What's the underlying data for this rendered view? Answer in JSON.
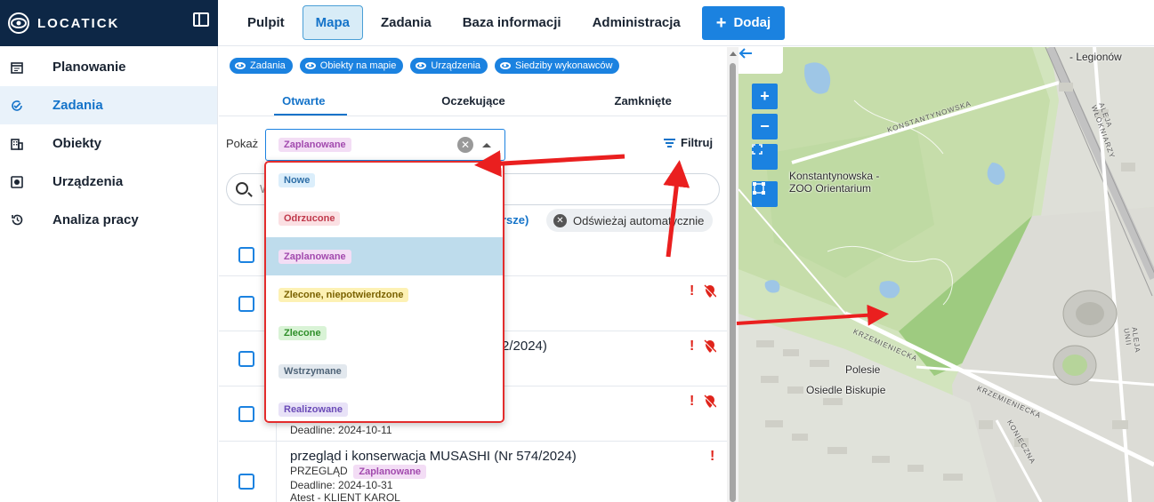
{
  "app": {
    "brand": "LOCATICK"
  },
  "sidebar": {
    "items": [
      {
        "label": "Planowanie",
        "icon": "calendar-icon"
      },
      {
        "label": "Zadania",
        "icon": "task-check-icon",
        "active": true
      },
      {
        "label": "Obiekty",
        "icon": "building-icon"
      },
      {
        "label": "Urządzenia",
        "icon": "device-icon"
      },
      {
        "label": "Analiza pracy",
        "icon": "history-icon"
      }
    ]
  },
  "topnav": {
    "items": [
      "Pulpit",
      "Mapa",
      "Zadania",
      "Baza informacji",
      "Administracja"
    ],
    "active": "Mapa",
    "add_label": "Dodaj"
  },
  "layers": [
    "Zadania",
    "Obiekty na mapie",
    "Urządzenia",
    "Siedziby wykonawców"
  ],
  "tabs": [
    "Otwarte",
    "Oczekujące",
    "Zamknięte"
  ],
  "filter": {
    "show_label": "Pokaż",
    "selected": "Zaplanowane",
    "filter_label": "Filtruj",
    "search_placeholder": "W",
    "partial_link": "rsze)",
    "auto_refresh": "Odświeżaj automatycznie"
  },
  "dropdown": {
    "options": [
      {
        "label": "Nowe",
        "bg": "#dbeefb",
        "fg": "#2f6fa7"
      },
      {
        "label": "Odrzucone",
        "bg": "#fbe0e3",
        "fg": "#c0394b"
      },
      {
        "label": "Zaplanowane",
        "bg": "#f3ddf5",
        "fg": "#a24aae",
        "selected": true
      },
      {
        "label": "Zlecone, niepotwierdzone",
        "bg": "#fdf1b4",
        "fg": "#7a6200"
      },
      {
        "label": "Zlecone",
        "bg": "#d9f3d6",
        "fg": "#2f8f2a"
      },
      {
        "label": "Wstrzymane",
        "bg": "#e2e8ee",
        "fg": "#4e6377"
      },
      {
        "label": "Realizowane",
        "bg": "#e8e2f7",
        "fg": "#6a4bb7"
      }
    ]
  },
  "tasks": [
    {
      "title_visible": "2/2024)",
      "meta": ""
    },
    {
      "title_visible": "",
      "meta": "Deadline: 2024-10-11"
    },
    {
      "title": "przegląd i konserwacja MUSASHI (Nr 574/2024)",
      "type": "PRZEGLĄD",
      "status": "Zaplanowane",
      "deadline": "Deadline: 2024-10-31",
      "client": "Atest - KLIENT KAROL"
    }
  ],
  "map": {
    "labels": {
      "zoo": "Konstantynowska -\nZOO Orientarium",
      "polesie": "Polesie",
      "osiedle": "Osiedle Biskupie",
      "legionow": "- Legionów",
      "konstantynowska": "KONSTANTYNOWSKA",
      "krzemieniecka1": "KRZEMIENIECKA",
      "krzemieniecka2": "KRZEMIENIECKA",
      "aleja_wlokniarzy": "ALEJA WŁÓKNIARZY",
      "aleja_unii": "ALEJA UNII",
      "konieczna": "KONIECZNA"
    },
    "controls": [
      "+",
      "−"
    ]
  },
  "colors": {
    "brand_navy": "#0d2746",
    "accent": "#1b82e0",
    "annotation_red": "#e32c2c"
  }
}
